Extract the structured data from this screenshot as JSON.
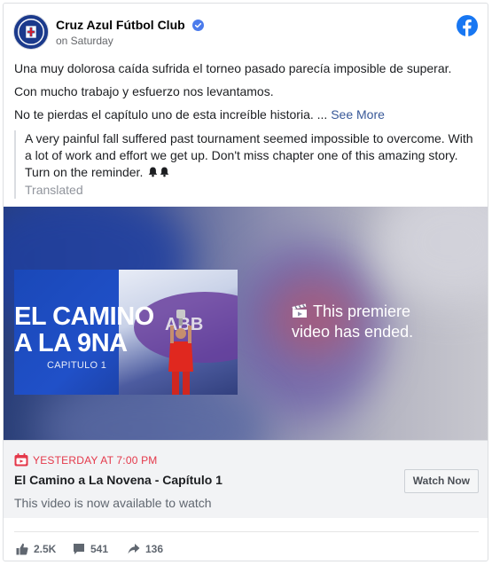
{
  "post": {
    "page_name": "Cruz Azul Fútbol Club",
    "time": "on Saturday",
    "lines": [
      "Una muy dolorosa caída sufrida el torneo pasado parecía imposible de superar.",
      "Con mucho trabajo y esfuerzo nos levantamos.",
      "No te pierdas el capítulo uno de esta increíble historia. ..."
    ],
    "see_more": "See More",
    "translation": "A very painful fall suffered past tournament seemed impossible to overcome. With a lot of work and effort we get up. Don't miss chapter one of this amazing story. Turn on the reminder.",
    "translated_label": "Translated"
  },
  "video": {
    "thumb_title_line1": "EL CAMINO",
    "thumb_title_line2": "A LA 9NA",
    "thumb_subtitle": "CAPITULO 1",
    "thumb_brand": "ABB",
    "premiere_line1": "This premiere",
    "premiere_line2": "video has ended."
  },
  "event": {
    "time": "YESTERDAY AT 7:00 PM",
    "title": "El Camino a La Novena - Capítulo 1",
    "description": "This video is now available to watch",
    "button": "Watch Now"
  },
  "stats": {
    "likes": "2.5K",
    "comments": "541",
    "shares": "136"
  },
  "colors": {
    "brand_blue": "#1877f2",
    "link": "#385898",
    "event_red": "#e4384a"
  },
  "icons": [
    "verified-icon",
    "facebook-logo-icon",
    "bell-icon",
    "clapperboard-icon",
    "calendar-icon",
    "like-icon",
    "comment-icon",
    "share-icon"
  ]
}
